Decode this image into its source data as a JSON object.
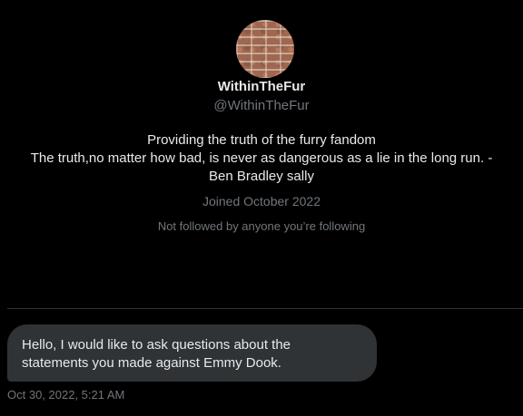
{
  "profile": {
    "display_name": "WithinTheFur",
    "handle": "@WithinTheFur",
    "bio": [
      "Providing the truth of the furry fandom",
      "The truth,no matter how bad, is never as dangerous as a lie in the long run.  -",
      "Ben Bradley sally"
    ],
    "joined": "Joined October 2022",
    "followed_by": "Not followed by anyone you’re following"
  },
  "messages": [
    {
      "lines": [
        "Hello, I would like to ask questions about the",
        "statements you made against Emmy Dook."
      ],
      "timestamp": "Oct 30, 2022, 5:21 AM"
    }
  ],
  "colors": {
    "background": "#000000",
    "text_primary": "#e7e9ea",
    "text_secondary": "#71767b",
    "bubble": "#2f3336",
    "divider": "#2f3336"
  }
}
